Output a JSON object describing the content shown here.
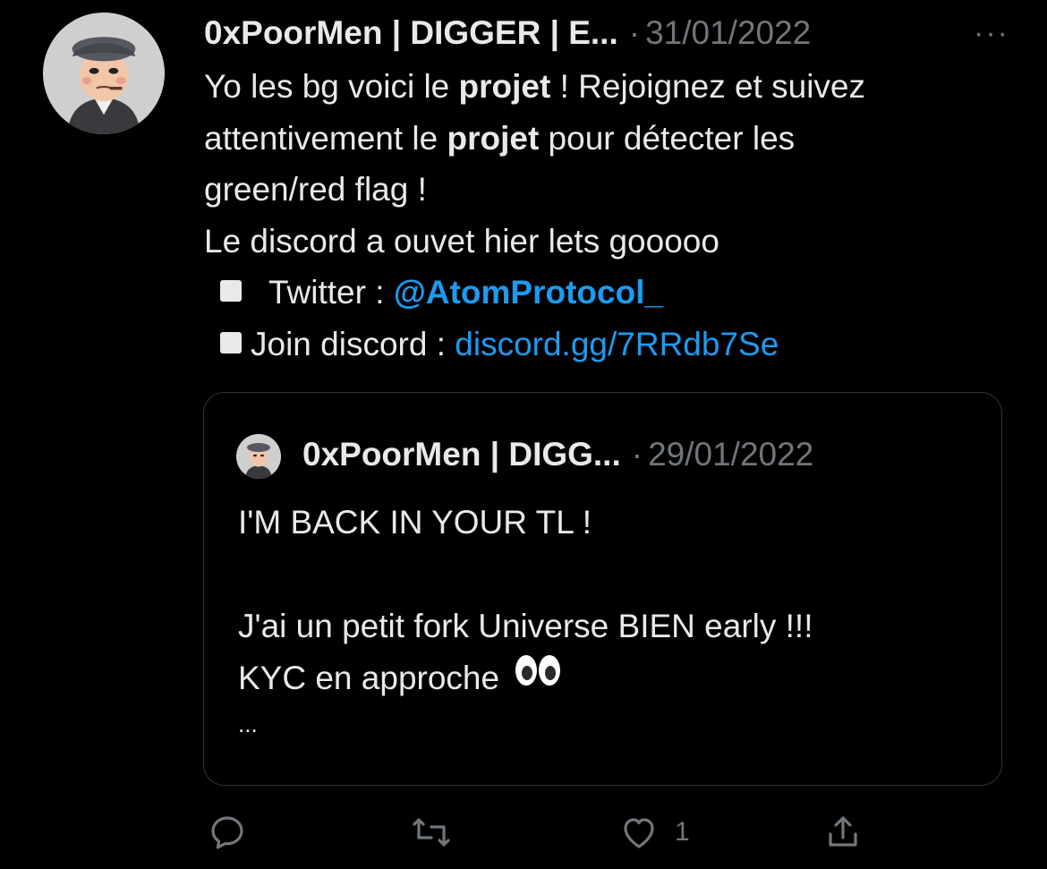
{
  "tweet": {
    "author_name": "0xPoorMen | DIGGER | E...",
    "separator": "·",
    "date": "31/01/2022",
    "more_label": "···",
    "lines": {
      "l1_a": "Yo les bg voici le ",
      "l1_b": "projet",
      "l1_c": " ! Rejoignez et suivez",
      "l2_a": "attentivement le ",
      "l2_b": "projet",
      "l2_c": " pour détecter les",
      "l3": "green/red flag !",
      "l4": "Le discord a ouvet hier lets gooooo",
      "l5_label": "Twitter : ",
      "l5_link": "@AtomProtocol_",
      "l6_label": "Join discord : ",
      "l6_link": "discord.gg/7RRdb7Se"
    }
  },
  "quoted": {
    "author_name": "0xPoorMen | DIGG...",
    "separator": "·",
    "date": "29/01/2022",
    "lines": {
      "l1": "I'M BACK IN YOUR TL !",
      "l2": "J'ai un petit fork Universe BIEN early !!!",
      "l3": "KYC en approche ",
      "l4": "..."
    }
  },
  "actions": {
    "reply_icon": "reply-icon",
    "retweet_icon": "retweet-icon",
    "like_icon": "heart-icon",
    "like_count": "1",
    "share_icon": "share-icon"
  },
  "colors": {
    "background": "#000000",
    "text": "#e7e9ea",
    "muted": "#71767b",
    "link": "#1d9bf0",
    "border": "#2f3336"
  }
}
